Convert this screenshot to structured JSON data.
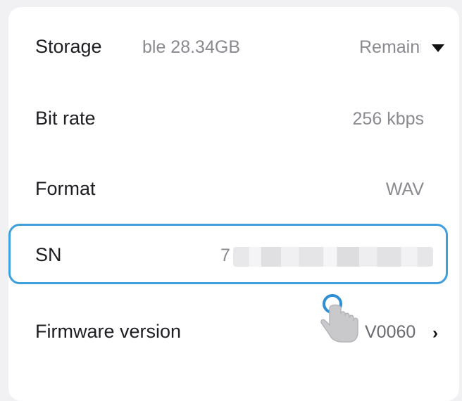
{
  "settings": {
    "storage": {
      "label": "Storage",
      "available": "ble 28.34GB",
      "mode": "Remaining",
      "dropdown_icon": "caret-down-icon"
    },
    "bit_rate": {
      "label": "Bit rate",
      "value": "256 kbps"
    },
    "format": {
      "label": "Format",
      "value": "WAV"
    },
    "sn": {
      "label": "SN",
      "value_prefix": "7",
      "value_redacted": true,
      "highlight_color": "#3ea0dd"
    },
    "firmware": {
      "label": "Firmware version",
      "value": "V0060",
      "chevron_icon": "chevron-right-icon"
    }
  },
  "overlay": {
    "cursor_icon": "tap-hand-icon"
  }
}
